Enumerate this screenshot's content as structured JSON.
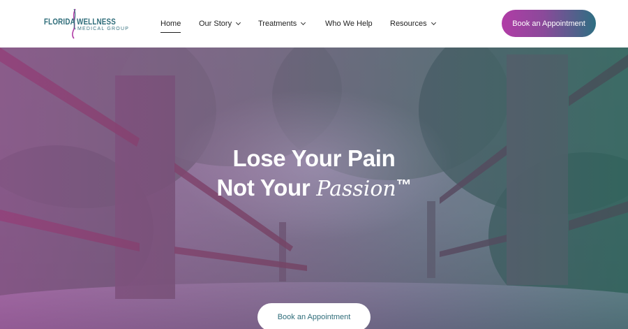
{
  "logo": {
    "word1": "FLORIDA",
    "word2": "WELLNESS",
    "word3": "MEDICAL GROUP"
  },
  "nav": {
    "items": [
      {
        "label": "Home",
        "active": true,
        "dropdown": false
      },
      {
        "label": "Our Story",
        "active": false,
        "dropdown": true
      },
      {
        "label": "Treatments",
        "active": false,
        "dropdown": true
      },
      {
        "label": "Who We Help",
        "active": false,
        "dropdown": false
      },
      {
        "label": "Resources",
        "active": false,
        "dropdown": true
      }
    ]
  },
  "header_cta": {
    "label": "Book an Appointment"
  },
  "hero": {
    "line1": "Lose Your Pain",
    "line2_plain": "Not Your ",
    "line2_script": "Passion",
    "line2_mark": "™",
    "cta_label": "Book an Appointment"
  },
  "colors": {
    "brand_teal": "#2f6d7a",
    "brand_magenta": "#b13ca6",
    "overlay_left": "#b24ab0",
    "overlay_right": "#286e78"
  },
  "icons": [
    "chevron-down-icon",
    "logo-swoosh-icon"
  ]
}
